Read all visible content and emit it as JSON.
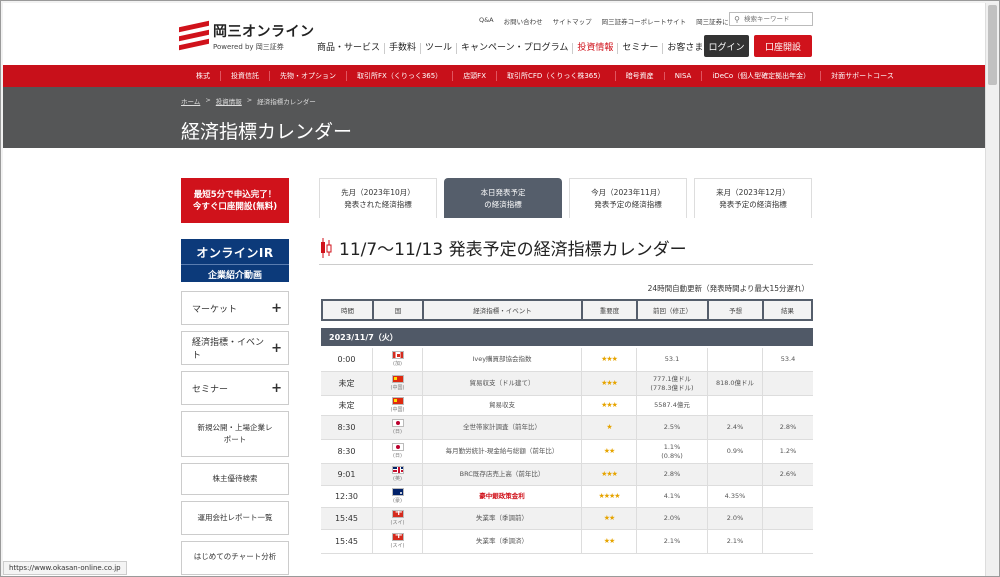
{
  "header": {
    "logo_name": "岡三オンライン",
    "logo_sub": "Powered by 岡三証券",
    "util_links": [
      "Q&A",
      "お問い合わせ",
      "サイトマップ",
      "岡三証券コーポレートサイト",
      "岡三証券について"
    ],
    "search_placeholder": "検索キーワード",
    "main_nav": [
      "商品・サービス",
      "手数料",
      "ツール",
      "キャンペーン・プログラム",
      "投資情報",
      "セミナー",
      "お客さまサポート"
    ],
    "login_label": "ログイン",
    "open_label": "口座開設"
  },
  "red_nav": [
    "株式",
    "投資信託",
    "先物・オプション",
    "取引所FX（くりっく365）",
    "店頭FX",
    "取引所CFD（くりっく株365）",
    "暗号資産",
    "NISA",
    "iDeCo（個人型確定拠出年金）",
    "対面サポートコース"
  ],
  "breadcrumb": {
    "home": "ホーム",
    "sep": ">",
    "parent": "投資情報",
    "current": "経済指標カレンダー"
  },
  "page_title": "経済指標カレンダー",
  "sidebar": {
    "cta_line1": "最短5分で申込完了！",
    "cta_line2": "今すぐ口座開設(無料)",
    "ir_line1": "オンラインIR",
    "ir_line2": "企業紹介動画",
    "accordions": [
      "マーケット",
      "経済指標・イベント",
      "セミナー"
    ],
    "plus": "+",
    "box1": "新規公開・上場企業レポート",
    "box2": "株主優待検索",
    "box3": "運用会社レポート一覧",
    "box4": "はじめてのチャート分析"
  },
  "tabs": [
    {
      "l1": "先月（2023年10月）",
      "l2": "発表された経済指標"
    },
    {
      "l1": "本日発表予定",
      "l2": "の経済指標"
    },
    {
      "l1": "今月（2023年11月）",
      "l2": "発表予定の経済指標"
    },
    {
      "l1": "来月（2023年12月）",
      "l2": "発表予定の経済指標"
    }
  ],
  "section_title": "11/7〜11/13 発表予定の経済指標カレンダー",
  "update_note": "24時間自動更新（発表時間より最大15分遅れ）",
  "table": {
    "headers": [
      "時間",
      "国",
      "経済指標・イベント",
      "重要度",
      "前回（修正）",
      "予想",
      "結果"
    ],
    "date_label": "2023/11/7（火）",
    "rows": [
      {
        "time": "0:00",
        "flag": "ca",
        "country": "(加)",
        "event": "Ivey購買部協会指数",
        "stars": "★★★",
        "prev": "53.1",
        "prev2": "",
        "forecast": "",
        "result": "53.4",
        "hl": false
      },
      {
        "time": "未定",
        "flag": "cn",
        "country": "(中国)",
        "event": "貿易収支（ドル建て）",
        "stars": "★★★",
        "prev": "777.1億ドル",
        "prev2": "(778.3億ドル)",
        "forecast": "818.0億ドル",
        "result": "",
        "hl": false
      },
      {
        "time": "未定",
        "flag": "cn",
        "country": "(中国)",
        "event": "貿易収支",
        "stars": "★★★",
        "prev": "5587.4億元",
        "prev2": "",
        "forecast": "",
        "result": "",
        "hl": false
      },
      {
        "time": "8:30",
        "flag": "jp",
        "country": "(日)",
        "event": "全世帯家計調査（前年比）",
        "stars": "★",
        "prev": "2.5%",
        "prev2": "",
        "forecast": "2.4%",
        "result": "2.8%",
        "hl": false
      },
      {
        "time": "8:30",
        "flag": "jp",
        "country": "(日)",
        "event": "毎月勤労統計-現金給与総額（前年比）",
        "stars": "★★",
        "prev": "1.1%",
        "prev2": "(0.8%)",
        "forecast": "0.9%",
        "result": "1.2%",
        "hl": false
      },
      {
        "time": "9:01",
        "flag": "gb",
        "country": "(英)",
        "event": "BRC既存店売上高（前年比）",
        "stars": "★★★",
        "prev": "2.8%",
        "prev2": "",
        "forecast": "",
        "result": "2.6%",
        "hl": false
      },
      {
        "time": "12:30",
        "flag": "au",
        "country": "(豪)",
        "event": "豪中銀政策金利",
        "stars": "★★★★",
        "prev": "4.1%",
        "prev2": "",
        "forecast": "4.35%",
        "result": "",
        "hl": true
      },
      {
        "time": "15:45",
        "flag": "ch",
        "country": "(スイ)",
        "event": "失業率（季調前）",
        "stars": "★★",
        "prev": "2.0%",
        "prev2": "",
        "forecast": "2.0%",
        "result": "",
        "hl": false
      },
      {
        "time": "15:45",
        "flag": "ch",
        "country": "(スイ)",
        "event": "失業率（季調済）",
        "stars": "★★",
        "prev": "2.1%",
        "prev2": "",
        "forecast": "2.1%",
        "result": "",
        "hl": false
      }
    ]
  },
  "status_url": "https://www.okasan-online.co.jp",
  "colors": {
    "brand_red": "#d0121b",
    "dark_band": "#555657",
    "table_head": "#555e6b",
    "ir_blue": "#0c3a7a",
    "star": "#e6a400"
  }
}
